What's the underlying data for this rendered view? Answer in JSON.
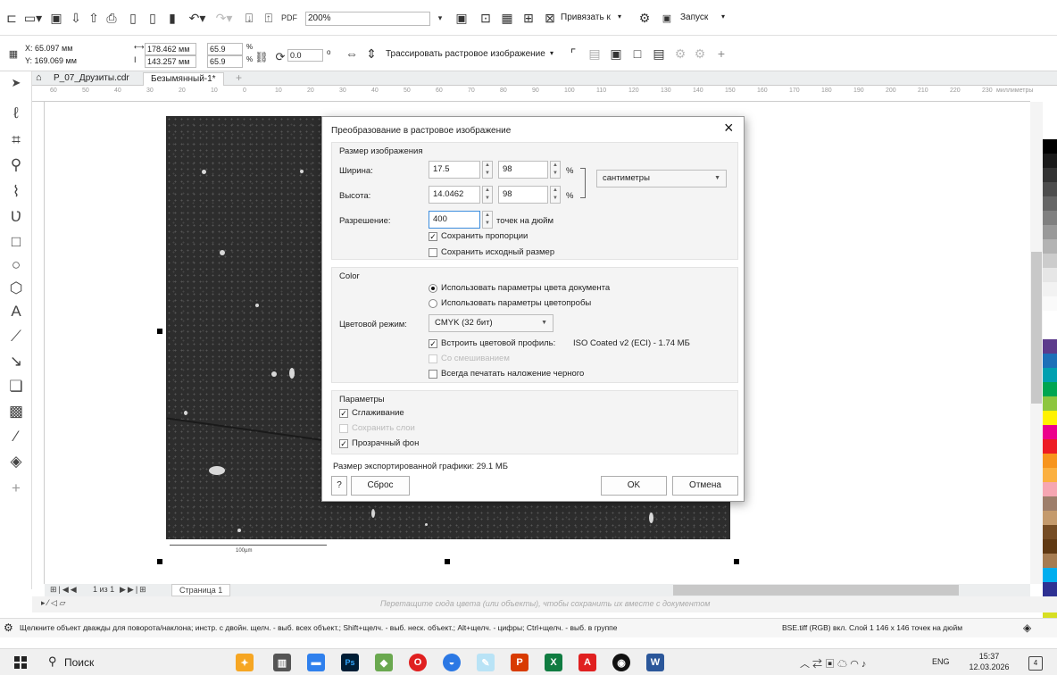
{
  "toolbar1": {
    "zoom": "200%",
    "snap_label": "Привязать к",
    "launch_label": "Запуск"
  },
  "toolbar2": {
    "x": "X: 65.097 мм",
    "y": "Y: 169.069 мм",
    "w": "178.462 мм",
    "h": "143.257 мм",
    "scale_w": "65.9",
    "scale_h": "65.9",
    "pct": "%",
    "angle": "0.0",
    "trace_label": "Трассировать растровое изображение"
  },
  "tabs": [
    {
      "label": "P_07_Друзиты.cdr"
    },
    {
      "label": "Безымянный-1*"
    }
  ],
  "ruler": {
    "ticks": [
      "60",
      "50",
      "40",
      "30",
      "20",
      "10",
      "0",
      "10",
      "20",
      "30",
      "40",
      "50",
      "60",
      "70",
      "80",
      "90",
      "100",
      "110",
      "120",
      "130",
      "140",
      "150",
      "160",
      "170",
      "180",
      "190",
      "200",
      "210",
      "220",
      "230"
    ],
    "unit": "миллиметры"
  },
  "photo": {
    "scalebar": "100µm"
  },
  "dialog": {
    "title": "Преобразование в растровое изображение",
    "size_group": {
      "title": "Размер изображения",
      "width_label": "Ширина:",
      "width_value": "17.5",
      "width_pct": "98",
      "height_label": "Высота:",
      "height_value": "14.0462",
      "height_pct": "98",
      "pct": "%",
      "unit": "сантиметры",
      "res_label": "Разрешение:",
      "res_value": "400",
      "res_unit": "точек на дюйм",
      "keep_ratio": "Сохранить пропорции",
      "keep_orig": "Сохранить исходный размер"
    },
    "color_group": {
      "title": "Color",
      "use_doc": "Использовать параметры цвета документа",
      "use_proof": "Использовать параметры цветопробы",
      "mode_label": "Цветовой режим:",
      "mode_value": "CMYK (32 бит)",
      "embed_label": "Встроить цветовой профиль:",
      "embed_value": "ISO Coated v2 (ECI) - 1.74 МБ",
      "dither": "Со смешиванием",
      "overprint": "Всегда печатать наложение черного"
    },
    "params_group": {
      "title": "Параметры",
      "smoothing": "Сглаживание",
      "keep_layers": "Сохранить слои",
      "transparent": "Прозрачный фон"
    },
    "export_size": "Размер экспортированной графики: 29.1 МБ",
    "help": "?",
    "reset": "Сброс",
    "ok": "OK",
    "cancel": "Отмена"
  },
  "pagebar": {
    "page_info": "1 из 1",
    "page_tab": "Страница 1"
  },
  "hint": "Перетащите сюда цвета (или объекты), чтобы сохранить их вместе с документом",
  "status": {
    "left": "Щелкните объект дважды для поворота/наклона; инстр. с двойн. щелч. - выб. всех объект.; Shift+щелч. - выб. неск. объект.; Alt+щелч. - цифры; Ctrl+щелч. - выб. в группе",
    "right": "BSE.tiff (RGB) вкл. Слой 1 146 x 146 точек на дюйм"
  },
  "taskbar": {
    "search": "Поиск",
    "lang": "ENG",
    "time": "15:37",
    "date": "12.03.2026",
    "notif": "4"
  },
  "palette": [
    "#ffffff",
    "#000000",
    "#1a1a1a",
    "#333333",
    "#4d4d4d",
    "#666666",
    "#808080",
    "#999999",
    "#b3b3b3",
    "#cccccc",
    "#e6e6e6",
    "#f2f2f2",
    "#fafafa",
    "#ffffff",
    "#ffffff",
    "#5c3b8c",
    "#1d70b8",
    "#00a0b0",
    "#00a651",
    "#8dc63f",
    "#fff200",
    "#ec008c",
    "#ed1c24",
    "#f7941d",
    "#fbb040",
    "#f6a6b2",
    "#9e7e6a",
    "#c49a6c",
    "#754c24",
    "#603913",
    "#a67c52",
    "#00aeef",
    "#2e3192",
    "#92278f",
    "#d7df23"
  ]
}
